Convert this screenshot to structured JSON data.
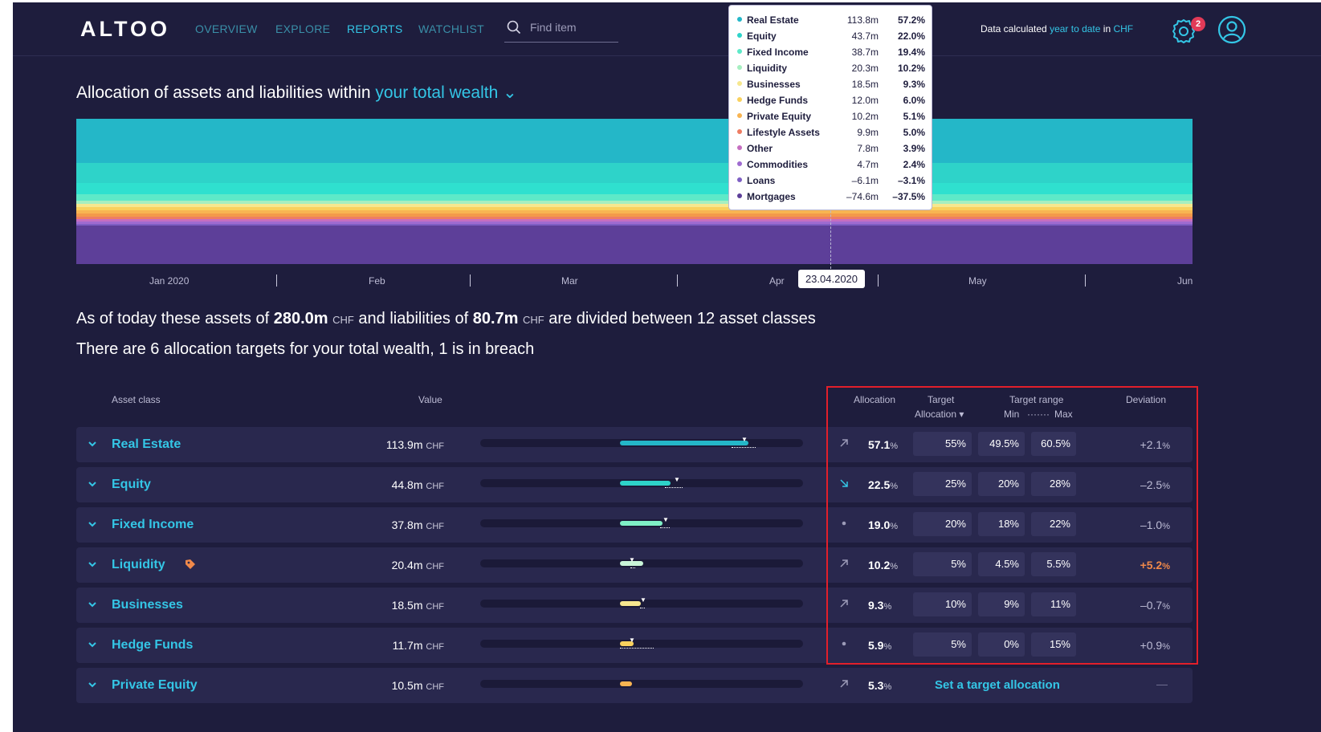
{
  "brand": {
    "logo": "ALTOO"
  },
  "nav": {
    "items": [
      {
        "label": "OVERVIEW",
        "active": false
      },
      {
        "label": "EXPLORE",
        "active": false
      },
      {
        "label": "REPORTS",
        "active": true
      },
      {
        "label": "WATCHLIST",
        "active": false
      }
    ]
  },
  "search": {
    "placeholder": "Find item",
    "icon": "search-icon"
  },
  "calc_note": {
    "prefix": "Data calculated",
    "period": "year to date",
    "mid": "in",
    "currency": "CHF"
  },
  "notifications": {
    "count": "2",
    "icon": "gear-icon"
  },
  "profile": {
    "icon": "user-icon"
  },
  "heading": {
    "text": "Allocation of assets and liabilities within",
    "scope": "your total wealth",
    "chevron": "⌄"
  },
  "stream_chart": {
    "x_labels": [
      "Jan 2020",
      "Feb",
      "Mar",
      "Apr",
      "May",
      "Jun"
    ],
    "selected_date": "23.04.2020",
    "series_colors": [
      "#24b7c8",
      "#2ed3c9",
      "#2fe0cf",
      "#5ee9c8",
      "#a6efc0",
      "#f6e78f",
      "#f9d15e",
      "#f8b452",
      "#f39a4a",
      "#ee7d63",
      "#c56ec0",
      "#9f6bd0",
      "#7e5fc4",
      "#5d3f99"
    ]
  },
  "tooltip": {
    "items": [
      {
        "name": "Real Estate",
        "value": "113.8m",
        "pct": "57.2%",
        "color": "#24b7c8"
      },
      {
        "name": "Equity",
        "value": "43.7m",
        "pct": "22.0%",
        "color": "#2ed3c9"
      },
      {
        "name": "Fixed Income",
        "value": "38.7m",
        "pct": "19.4%",
        "color": "#5ee9c8"
      },
      {
        "name": "Liquidity",
        "value": "20.3m",
        "pct": "10.2%",
        "color": "#a6efc0"
      },
      {
        "name": "Businesses",
        "value": "18.5m",
        "pct": "9.3%",
        "color": "#f6e78f"
      },
      {
        "name": "Hedge Funds",
        "value": "12.0m",
        "pct": "6.0%",
        "color": "#f9d15e"
      },
      {
        "name": "Private Equity",
        "value": "10.2m",
        "pct": "5.1%",
        "color": "#f8b452"
      },
      {
        "name": "Lifestyle Assets",
        "value": "9.9m",
        "pct": "5.0%",
        "color": "#ee7d63"
      },
      {
        "name": "Other",
        "value": "7.8m",
        "pct": "3.9%",
        "color": "#c56ec0"
      },
      {
        "name": "Commodities",
        "value": "4.7m",
        "pct": "2.4%",
        "color": "#9f6bd0"
      },
      {
        "name": "Loans",
        "value": "–6.1m",
        "pct": "–3.1%",
        "color": "#7e5fc4"
      },
      {
        "name": "Mortgages",
        "value": "–74.6m",
        "pct": "–37.5%",
        "color": "#5d3f99"
      }
    ]
  },
  "summary": {
    "p1": "As of today these assets of",
    "assets": "280.0m",
    "cur1": "CHF",
    "p2": "and liabilities of",
    "liabilities": "80.7m",
    "cur2": "CHF",
    "p3": "are divided between 12 asset classes",
    "targets_line": "There are 6 allocation targets for your total wealth, 1 is in breach"
  },
  "table": {
    "headers": {
      "asset_class": "Asset class",
      "value": "Value",
      "allocation": "Allocation",
      "target": "Target",
      "target_sub": "Allocation ▾",
      "target_range": "Target range",
      "range_min": "Min",
      "range_dots": "·······",
      "range_max": "Max",
      "deviation": "Deviation"
    },
    "rows": [
      {
        "name": "Real Estate",
        "value": "113.9m",
        "unit": "CHF",
        "alloc": "57.1",
        "pc": "%",
        "trend": "up",
        "target": "55%",
        "min": "49.5%",
        "max": "60.5%",
        "dev": "+2.1",
        "breach": false,
        "color": "#24b7c8",
        "alloc_frac": 0.571,
        "target_frac": 0.55,
        "min_frac": 0.495,
        "max_frac": 0.605
      },
      {
        "name": "Equity",
        "value": "44.8m",
        "unit": "CHF",
        "alloc": "22.5",
        "pc": "%",
        "trend": "down",
        "target": "25%",
        "min": "20%",
        "max": "28%",
        "dev": "–2.5",
        "breach": false,
        "color": "#2ed3c9",
        "alloc_frac": 0.225,
        "target_frac": 0.25,
        "min_frac": 0.2,
        "max_frac": 0.28
      },
      {
        "name": "Fixed Income",
        "value": "37.8m",
        "unit": "CHF",
        "alloc": "19.0",
        "pc": "%",
        "trend": "flat",
        "target": "20%",
        "min": "18%",
        "max": "22%",
        "dev": "–1.0",
        "breach": false,
        "color": "#7ff0c6",
        "alloc_frac": 0.19,
        "target_frac": 0.2,
        "min_frac": 0.18,
        "max_frac": 0.22
      },
      {
        "name": "Liquidity",
        "value": "20.4m",
        "unit": "CHF",
        "alloc": "10.2",
        "pc": "%",
        "trend": "up",
        "target": "5%",
        "min": "4.5%",
        "max": "5.5%",
        "dev": "+5.2",
        "breach": true,
        "color": "#c9f5d8",
        "alloc_frac": 0.102,
        "target_frac": 0.05,
        "min_frac": 0.045,
        "max_frac": 0.055
      },
      {
        "name": "Businesses",
        "value": "18.5m",
        "unit": "CHF",
        "alloc": "9.3",
        "pc": "%",
        "trend": "up",
        "target": "10%",
        "min": "9%",
        "max": "11%",
        "dev": "–0.7",
        "breach": false,
        "color": "#f6e78f",
        "alloc_frac": 0.093,
        "target_frac": 0.1,
        "min_frac": 0.09,
        "max_frac": 0.11
      },
      {
        "name": "Hedge Funds",
        "value": "11.7m",
        "unit": "CHF",
        "alloc": "5.9",
        "pc": "%",
        "trend": "flat",
        "target": "5%",
        "min": "0%",
        "max": "15%",
        "dev": "+0.9",
        "breach": false,
        "color": "#f9d15e",
        "alloc_frac": 0.059,
        "target_frac": 0.05,
        "min_frac": 0.0,
        "max_frac": 0.15
      },
      {
        "name": "Private Equity",
        "value": "10.5m",
        "unit": "CHF",
        "alloc": "5.3",
        "pc": "%",
        "trend": "up",
        "target": null,
        "min": null,
        "max": null,
        "dev": "—",
        "breach": false,
        "color": "#f8b452",
        "alloc_frac": 0.053,
        "set_target_label": "Set a target allocation"
      }
    ]
  }
}
